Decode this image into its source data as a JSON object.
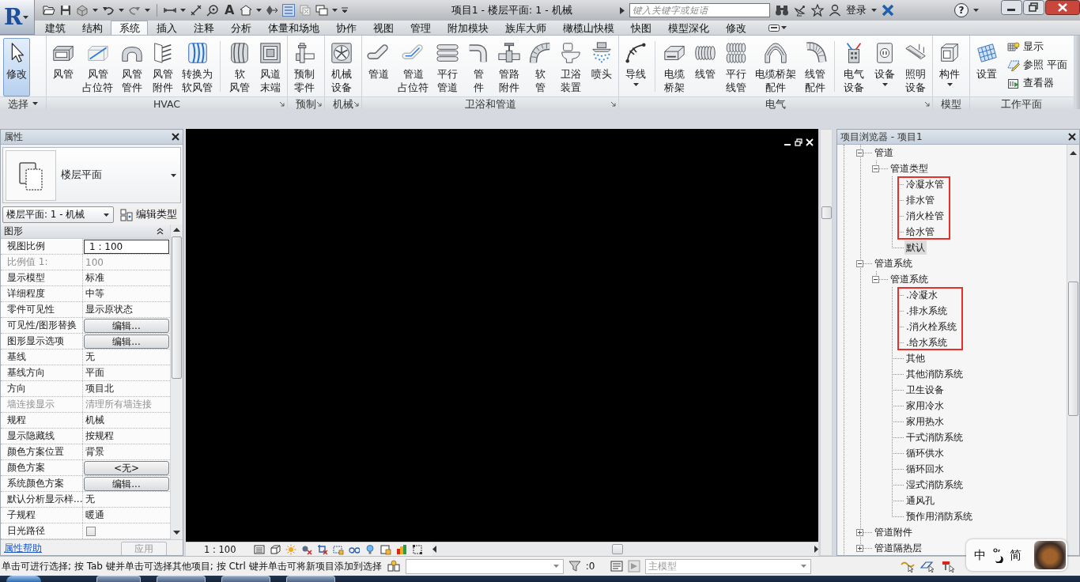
{
  "application_menu": {
    "logo": "R"
  },
  "quick_access": {
    "text_tool": "A",
    "thin_lines": true
  },
  "title_bar": {
    "title": "项目1 - 楼层平面: 1 - 机械",
    "search": {
      "placeholder": "键入关键字或短语"
    },
    "sign_in": "登录",
    "help": "?"
  },
  "tabs": [
    {
      "label": "建筑",
      "selected": false
    },
    {
      "label": "结构",
      "selected": false
    },
    {
      "label": "系统",
      "selected": true
    },
    {
      "label": "插入",
      "selected": false
    },
    {
      "label": "注释",
      "selected": false
    },
    {
      "label": "分析",
      "selected": false
    },
    {
      "label": "体量和场地",
      "selected": false
    },
    {
      "label": "协作",
      "selected": false
    },
    {
      "label": "视图",
      "selected": false
    },
    {
      "label": "管理",
      "selected": false
    },
    {
      "label": "附加模块",
      "selected": false
    },
    {
      "label": "族库大师",
      "selected": false
    },
    {
      "label": "橄榄山快模",
      "selected": false
    },
    {
      "label": "快图",
      "selected": false
    },
    {
      "label": "模型深化",
      "selected": false
    },
    {
      "label": "修改",
      "selected": false
    }
  ],
  "ribbon": {
    "panels": [
      {
        "title": "选择",
        "menu": true,
        "launcher": false,
        "groups": [
          {
            "kind": "large",
            "tools": [
              {
                "lines": [
                  "修改"
                ],
                "dropdown": false,
                "active": true
              }
            ]
          }
        ]
      },
      {
        "title": "HVAC",
        "menu": false,
        "launcher": true,
        "groups": [
          {
            "kind": "large",
            "tools": [
              {
                "lines": [
                  "风管"
                ],
                "dropdown": false,
                "active": false
              },
              {
                "lines": [
                  "风管",
                  "占位符"
                ],
                "dropdown": false,
                "active": false
              },
              {
                "lines": [
                  "风管",
                  "管件"
                ],
                "dropdown": false,
                "active": false
              },
              {
                "lines": [
                  "风管",
                  "附件"
                ],
                "dropdown": false,
                "active": false
              },
              {
                "lines": [
                  "转换为",
                  "软风管"
                ],
                "dropdown": false,
                "active": false
              }
            ]
          },
          {
            "kind": "large",
            "tools": [
              {
                "lines": [
                  "软",
                  "风管"
                ],
                "dropdown": false,
                "active": false
              },
              {
                "lines": [
                  "风道",
                  "末端"
                ],
                "dropdown": false,
                "active": false
              }
            ]
          }
        ]
      },
      {
        "title": "预制",
        "menu": false,
        "launcher": true,
        "groups": [
          {
            "kind": "large",
            "tools": [
              {
                "lines": [
                  "预制",
                  "零件"
                ],
                "dropdown": false,
                "active": false
              }
            ]
          }
        ]
      },
      {
        "title": "机械",
        "menu": false,
        "launcher": true,
        "groups": [
          {
            "kind": "large",
            "tools": [
              {
                "lines": [
                  "机械",
                  "设备"
                ],
                "dropdown": false,
                "active": false
              }
            ]
          }
        ]
      },
      {
        "title": "卫浴和管道",
        "menu": false,
        "launcher": true,
        "groups": [
          {
            "kind": "large",
            "tools": [
              {
                "lines": [
                  "管道"
                ],
                "dropdown": false,
                "active": false
              },
              {
                "lines": [
                  "管道",
                  "占位符"
                ],
                "dropdown": false,
                "active": false
              },
              {
                "lines": [
                  "平行",
                  "管道"
                ],
                "dropdown": false,
                "active": false
              },
              {
                "lines": [
                  "管",
                  "件"
                ],
                "dropdown": false,
                "active": false
              },
              {
                "lines": [
                  "管路",
                  "附件"
                ],
                "dropdown": false,
                "active": false
              },
              {
                "lines": [
                  "软",
                  "管"
                ],
                "dropdown": false,
                "active": false
              },
              {
                "lines": [
                  "卫浴",
                  "装置"
                ],
                "dropdown": false,
                "active": false
              },
              {
                "lines": [
                  "喷头"
                ],
                "dropdown": false,
                "active": false
              }
            ]
          }
        ]
      },
      {
        "title": "电气",
        "menu": false,
        "launcher": true,
        "groups": [
          {
            "kind": "large",
            "tools": [
              {
                "lines": [
                  "导线"
                ],
                "dropdown": true,
                "active": false
              }
            ]
          },
          {
            "kind": "large",
            "tools": [
              {
                "lines": [
                  "电缆",
                  "桥架"
                ],
                "dropdown": false,
                "active": false
              },
              {
                "lines": [
                  "线管"
                ],
                "dropdown": false,
                "active": false
              },
              {
                "lines": [
                  "平行",
                  "线管"
                ],
                "dropdown": false,
                "active": false
              },
              {
                "lines": [
                  "电缆桥架",
                  "配件"
                ],
                "dropdown": false,
                "active": false
              },
              {
                "lines": [
                  "线管",
                  "配件"
                ],
                "dropdown": false,
                "active": false
              }
            ]
          },
          {
            "kind": "large",
            "tools": [
              {
                "lines": [
                  "电气",
                  "设备"
                ],
                "dropdown": false,
                "active": false
              },
              {
                "lines": [
                  "设备"
                ],
                "dropdown": true,
                "active": false
              },
              {
                "lines": [
                  "照明",
                  "设备"
                ],
                "dropdown": false,
                "active": false
              }
            ]
          }
        ]
      },
      {
        "title": "模型",
        "menu": false,
        "launcher": false,
        "groups": [
          {
            "kind": "large",
            "tools": [
              {
                "lines": [
                  "构件"
                ],
                "dropdown": true,
                "active": false
              }
            ]
          }
        ]
      },
      {
        "title": "工作平面",
        "menu": false,
        "launcher": false,
        "groups": [
          {
            "kind": "large",
            "tools": [
              {
                "lines": [
                  "设置"
                ],
                "dropdown": false,
                "active": false
              }
            ]
          },
          {
            "kind": "stack",
            "tools": [
              {
                "lines": [
                  "显示"
                ],
                "dropdown": false,
                "active": false
              },
              {
                "lines": [
                  "参照 平面"
                ],
                "dropdown": false,
                "active": false
              },
              {
                "lines": [
                  "查看器"
                ],
                "dropdown": false,
                "active": false
              }
            ]
          }
        ]
      }
    ]
  },
  "properties": {
    "title": "属性",
    "type_name": "楼层平面",
    "instance": "楼层平面: 1 - 机械",
    "edit_type": "编辑类型",
    "group": {
      "title": "图形",
      "expanded": true
    },
    "rows": [
      {
        "label": "视图比例",
        "value": "1 : 100",
        "kind": "input",
        "disabled": false
      },
      {
        "label": "比例值 1:",
        "value": "100",
        "kind": "text",
        "disabled": true
      },
      {
        "label": "显示模型",
        "value": "标准",
        "kind": "text",
        "disabled": false
      },
      {
        "label": "详细程度",
        "value": "中等",
        "kind": "text",
        "disabled": false
      },
      {
        "label": "零件可见性",
        "value": "显示原状态",
        "kind": "text",
        "disabled": false
      },
      {
        "label": "可见性/图形替换",
        "value": "编辑...",
        "kind": "button",
        "disabled": false
      },
      {
        "label": "图形显示选项",
        "value": "编辑...",
        "kind": "button",
        "disabled": false
      },
      {
        "label": "基线",
        "value": "无",
        "kind": "text",
        "disabled": false
      },
      {
        "label": "基线方向",
        "value": "平面",
        "kind": "text",
        "disabled": false
      },
      {
        "label": "方向",
        "value": "项目北",
        "kind": "text",
        "disabled": false
      },
      {
        "label": "墙连接显示",
        "value": "清理所有墙连接",
        "kind": "text",
        "disabled": true
      },
      {
        "label": "规程",
        "value": "机械",
        "kind": "text",
        "disabled": false
      },
      {
        "label": "显示隐藏线",
        "value": "按规程",
        "kind": "text",
        "disabled": false
      },
      {
        "label": "颜色方案位置",
        "value": "背景",
        "kind": "text",
        "disabled": false
      },
      {
        "label": "颜色方案",
        "value": "<无>",
        "kind": "button",
        "disabled": false
      },
      {
        "label": "系统颜色方案",
        "value": "编辑...",
        "kind": "button",
        "disabled": false
      },
      {
        "label": "默认分析显示样...",
        "value": "无",
        "kind": "text",
        "disabled": false
      },
      {
        "label": "子规程",
        "value": "暖通",
        "kind": "text",
        "disabled": false
      },
      {
        "label": "日光路径",
        "kind": "checkbox",
        "checked": false,
        "disabled": false
      }
    ],
    "help": "属性帮助",
    "apply": {
      "label": "应用",
      "disabled": true
    }
  },
  "view": {
    "scale": "1 : 100"
  },
  "project_browser": {
    "title": "项目浏览器 - 项目1",
    "tree": [
      {
        "label": "管道",
        "expanded": true,
        "selected": false,
        "children": [
          {
            "label": "管道类型",
            "expanded": true,
            "selected": false,
            "children": [
              {
                "label": "冷凝水管",
                "selected": false,
                "marked": true
              },
              {
                "label": "排水管",
                "selected": false,
                "marked": true
              },
              {
                "label": "消火栓管",
                "selected": false,
                "marked": true
              },
              {
                "label": "给水管",
                "selected": false,
                "marked": true
              },
              {
                "label": "默认",
                "selected": true,
                "marked": false
              }
            ]
          }
        ]
      },
      {
        "label": "管道系统",
        "expanded": true,
        "selected": false,
        "children": [
          {
            "label": "管道系统",
            "expanded": true,
            "selected": false,
            "children": [
              {
                "label": ".冷凝水",
                "selected": false,
                "marked": true
              },
              {
                "label": ".排水系统",
                "selected": false,
                "marked": true
              },
              {
                "label": ".消火栓系统",
                "selected": false,
                "marked": true
              },
              {
                "label": ".给水系统",
                "selected": false,
                "marked": true
              },
              {
                "label": "其他",
                "selected": false,
                "marked": false
              },
              {
                "label": "其他消防系统",
                "selected": false,
                "marked": false
              },
              {
                "label": "卫生设备",
                "selected": false,
                "marked": false
              },
              {
                "label": "家用冷水",
                "selected": false,
                "marked": false
              },
              {
                "label": "家用热水",
                "selected": false,
                "marked": false
              },
              {
                "label": "干式消防系统",
                "selected": false,
                "marked": false
              },
              {
                "label": "循环供水",
                "selected": false,
                "marked": false
              },
              {
                "label": "循环回水",
                "selected": false,
                "marked": false
              },
              {
                "label": "湿式消防系统",
                "selected": false,
                "marked": false
              },
              {
                "label": "通风孔",
                "selected": false,
                "marked": false
              },
              {
                "label": "预作用消防系统",
                "selected": false,
                "marked": false
              }
            ]
          }
        ]
      },
      {
        "label": "管道附件",
        "expanded": false,
        "selected": false
      },
      {
        "label": "管道隔热层",
        "expanded": false,
        "selected": false
      }
    ]
  },
  "status_bar": {
    "message": "单击可进行选择; 按 Tab 键并单击可选择其他项目; 按 Ctrl 键并单击可将新项目添加到选择",
    "filter_count": ":0",
    "design_option": {
      "value": "主模型",
      "disabled": true
    }
  },
  "ime_bar": {
    "mode": "中",
    "script": "简"
  }
}
